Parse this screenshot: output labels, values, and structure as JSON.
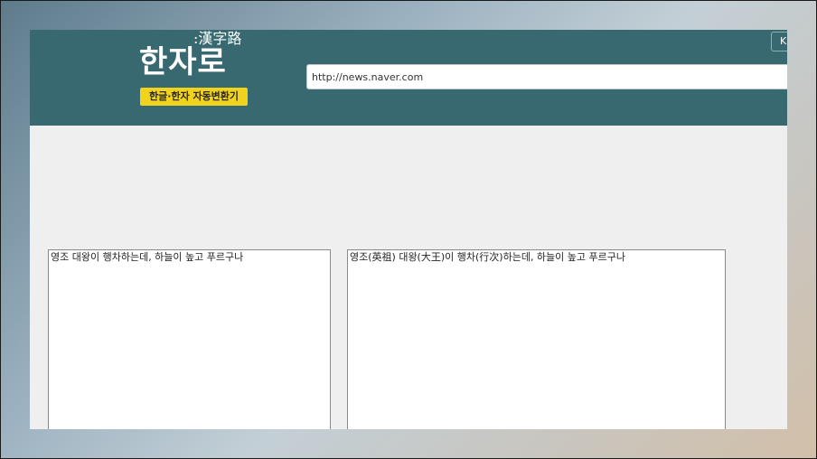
{
  "header": {
    "logo_hanja": ":漢字路",
    "logo_title": "한자로",
    "logo_tagline": "한글·한자 자동변환기",
    "top_button_label": "K"
  },
  "url_bar": {
    "value": "http://news.naver.com"
  },
  "editor": {
    "source_text": "영조 대왕이 행차하는데, 하늘이 높고 푸르구나",
    "converted_text": "영조(英祖) 대왕(大王)이 행차(行次)하는데, 하늘이 높고 푸르구나"
  },
  "colors": {
    "header_bg": "#386971",
    "badge_bg": "#f1d21c",
    "content_bg": "#efefef"
  }
}
